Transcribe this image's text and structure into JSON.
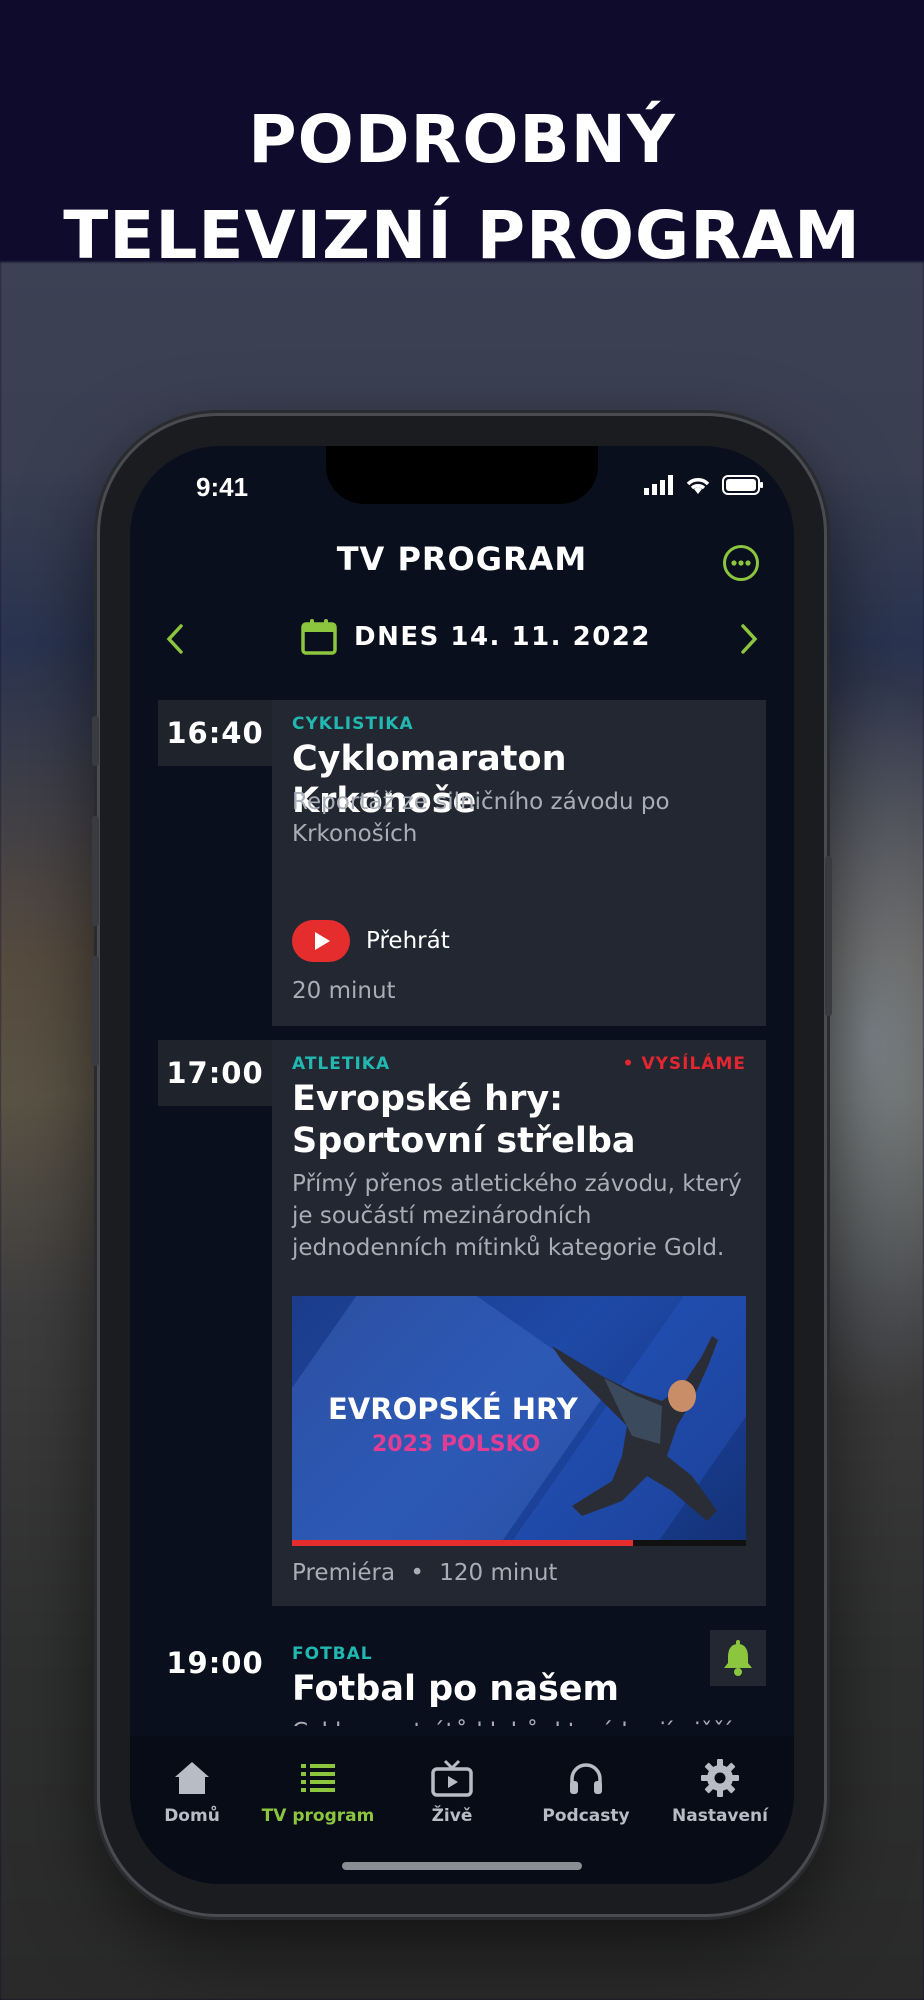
{
  "promo": {
    "headline_line1": "PODROBNÝ",
    "headline_line2": "TELEVIZNÍ PROGRAM"
  },
  "status_bar": {
    "time": "9:41"
  },
  "header": {
    "title": "TV PROGRAM",
    "more_icon": "more-icon"
  },
  "date_nav": {
    "label": "DNES 14. 11. 2022",
    "accent": "#8cc63f"
  },
  "programs": [
    {
      "time": "16:40",
      "category": "CYKLISTIKA",
      "title": "Cyklomaraton Krkonoše",
      "description": "Reportáž ze silničního závodu po Krkonoších",
      "play_label": "Přehrát",
      "meta": "20 minut"
    },
    {
      "time": "17:00",
      "category": "ATLETIKA",
      "live_label": "• VYSÍLÁME",
      "title": "Evropské hry: Sportovní střelba",
      "description": "Přímý přenos atletického závodu, který je součástí mezinárodních jednodenních mítinků kategorie Gold.",
      "thumbnail_line1": "EVROPSKÉ HRY",
      "thumbnail_line2": "2023 POLSKO",
      "progress": 0.75,
      "meta_premiere": "Premiéra",
      "meta_sep": "•",
      "meta_duration": "120 minut"
    },
    {
      "time": "19:00",
      "category": "FOTBAL",
      "title": "Fotbal po našem",
      "description": "Cyklus portrétů klubů, které hrají nižší"
    }
  ],
  "tabs": [
    {
      "label": "Domů",
      "icon": "home-icon",
      "active": false
    },
    {
      "label": "TV program",
      "icon": "list-icon",
      "active": true
    },
    {
      "label": "Živě",
      "icon": "tv-icon",
      "active": false
    },
    {
      "label": "Podcasty",
      "icon": "headphones-icon",
      "active": false
    },
    {
      "label": "Nastavení",
      "icon": "gear-icon",
      "active": false
    }
  ],
  "colors": {
    "accent_green": "#8cc63f",
    "category_teal": "#22b8b2",
    "live_red": "#e3262f",
    "background": "#0a0f1e"
  }
}
